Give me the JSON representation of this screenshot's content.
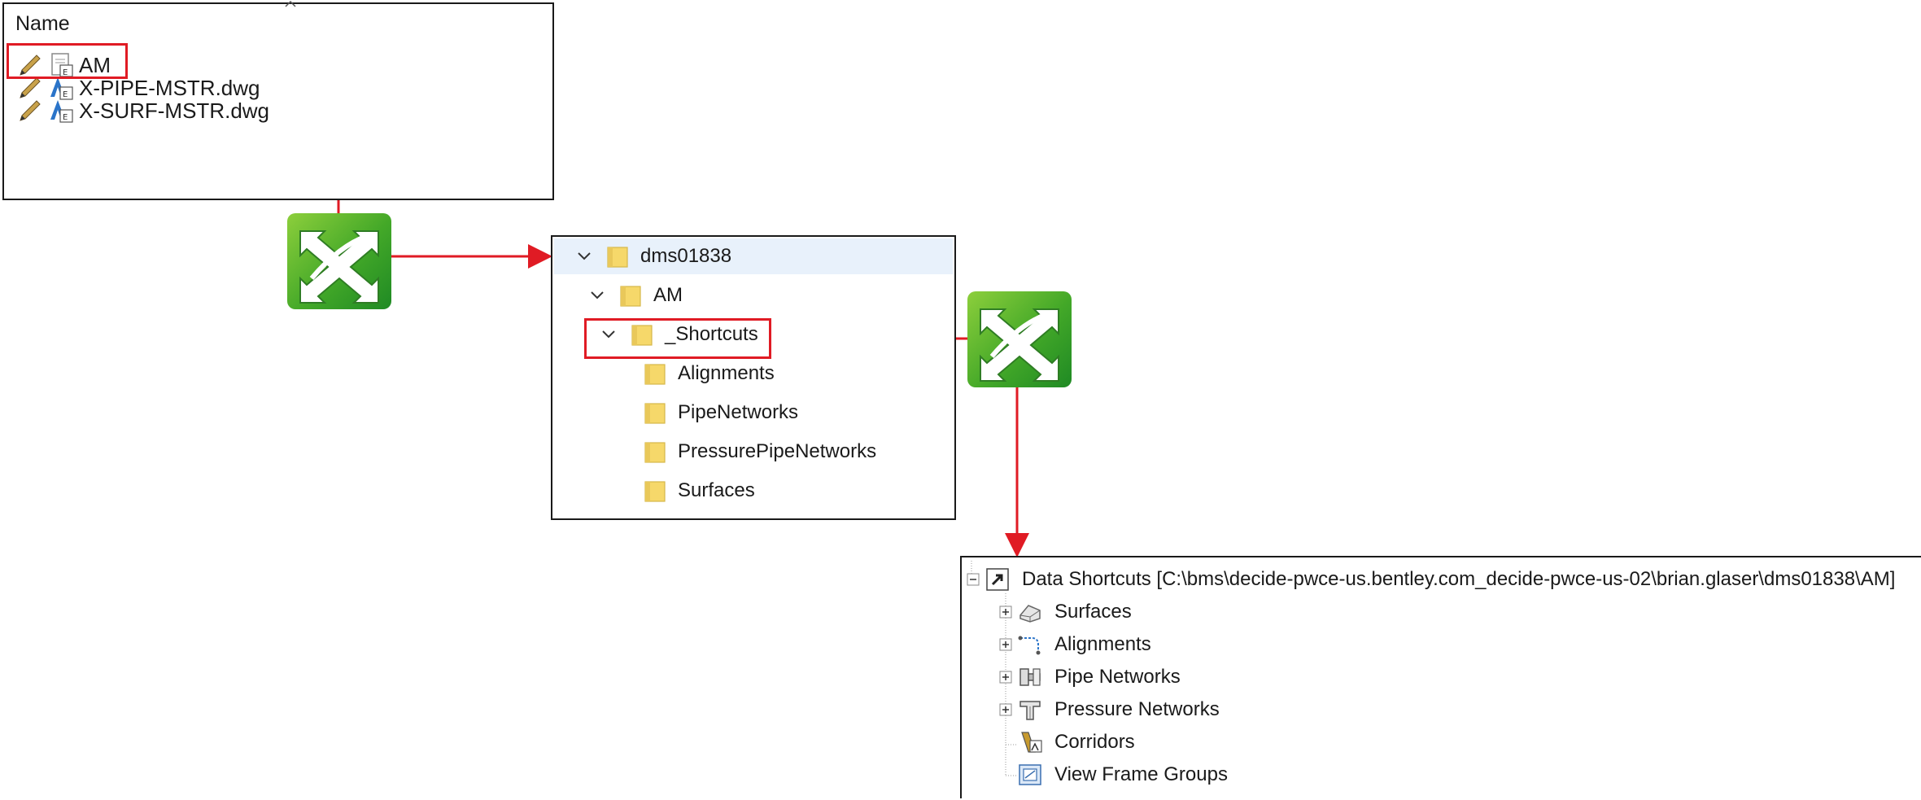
{
  "file_list": {
    "column_header": "Name",
    "items": [
      {
        "label": "AM",
        "icon": "folder-document-icon"
      },
      {
        "label": "X-PIPE-MSTR.dwg",
        "icon": "dwg-file-icon"
      },
      {
        "label": "X-SURF-MSTR.dwg",
        "icon": "dwg-file-icon"
      }
    ]
  },
  "folder_tree": {
    "items": [
      {
        "label": "dms01838"
      },
      {
        "label": "AM"
      },
      {
        "label": "_Shortcuts"
      },
      {
        "label": "Alignments"
      },
      {
        "label": "PipeNetworks"
      },
      {
        "label": "PressurePipeNetworks"
      },
      {
        "label": "Surfaces"
      }
    ]
  },
  "data_shortcuts": {
    "root_label": "Data Shortcuts [C:\\bms\\decide-pwce-us.bentley.com_decide-pwce-us-02\\brian.glaser\\dms01838\\AM]",
    "items": [
      {
        "label": "Surfaces",
        "icon": "surface-icon"
      },
      {
        "label": "Alignments",
        "icon": "alignment-icon"
      },
      {
        "label": "Pipe Networks",
        "icon": "pipe-network-icon"
      },
      {
        "label": "Pressure Networks",
        "icon": "pressure-network-icon"
      },
      {
        "label": "Corridors",
        "icon": "corridor-icon"
      },
      {
        "label": "View Frame Groups",
        "icon": "view-frame-group-icon"
      }
    ]
  },
  "colors": {
    "highlight": "#e01b24",
    "sync_green": "#43a828",
    "selection": "#e8f1fb",
    "folder_yellow": "#f6d86a"
  }
}
